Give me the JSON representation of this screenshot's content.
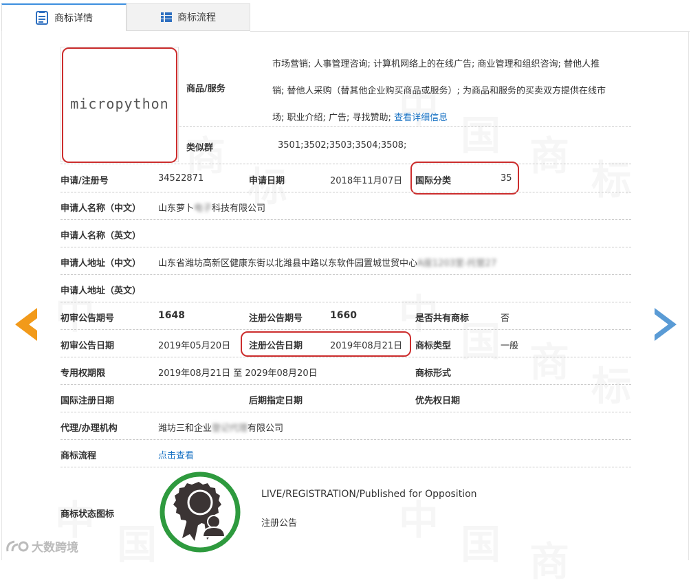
{
  "tabs": [
    {
      "label": "商标详情",
      "icon": "document-icon",
      "active": true
    },
    {
      "label": "商标流程",
      "icon": "list-icon",
      "active": false
    }
  ],
  "logo_text": "micropython",
  "goods": {
    "label": "商品/服务",
    "lines": [
      "市场营销; 人事管理咨询; 计算机网络上的在线广告; 商业管理和组织咨询; 替他人推",
      "销; 替他人采购（替其他企业购买商品或服务）; 为商品和服务的买卖双方提供在线市",
      "场; 职业介绍; 广告; 寻找赞助; "
    ],
    "link": "查看详细信息"
  },
  "similar_group": {
    "label": "类似群",
    "value": "3501;3502;3503;3504;3508;"
  },
  "fields": {
    "reg_no": {
      "label": "申请/注册号",
      "value": "34522871"
    },
    "apply_date": {
      "label": "申请日期",
      "value": "2018年11月07日"
    },
    "intl_class": {
      "label": "国际分类",
      "value": "35"
    },
    "applicant_cn": {
      "label": "申请人名称（中文）",
      "value_a": "山东萝卜",
      "value_blur": "电子",
      "value_b": "科技有限公司"
    },
    "applicant_en": {
      "label": "申请人名称（英文）",
      "value": ""
    },
    "address_cn": {
      "label": "申请人地址（中文）",
      "value": "山东省潍坊高新区健康东街以北潍县中路以东软件园置城世贸中心",
      "value_blur": "A座1203室-托管27"
    },
    "address_en": {
      "label": "申请人地址（英文）",
      "value": ""
    },
    "prelim_no": {
      "label": "初审公告期号",
      "value": "1648"
    },
    "reg_pub_no": {
      "label": "注册公告期号",
      "value": "1660"
    },
    "shared": {
      "label": "是否共有商标",
      "value": "否"
    },
    "prelim_date": {
      "label": "初审公告日期",
      "value": "2019年05月20日"
    },
    "reg_pub_date": {
      "label": "注册公告日期",
      "value": "2019年08月21日"
    },
    "tm_type": {
      "label": "商标类型",
      "value": "一般"
    },
    "exclusive": {
      "label": "专用权期限",
      "value": "2019年08月21日 至 2029年08月20日"
    },
    "tm_form": {
      "label": "商标形式",
      "value": ""
    },
    "intl_reg_date": {
      "label": "国际注册日期",
      "value": ""
    },
    "later_date": {
      "label": "后期指定日期",
      "value": ""
    },
    "priority_date": {
      "label": "优先权日期",
      "value": ""
    },
    "agent": {
      "label": "代理/办理机构",
      "value_a": "潍坊三和企业",
      "value_blur": "登记代理",
      "value_b": "有限公司"
    },
    "flow": {
      "label": "商标流程",
      "link": "点击查看"
    },
    "status_icon": {
      "label": "商标状态图标"
    }
  },
  "status": {
    "line1": "LIVE/REGISTRATION/Published for Opposition",
    "line2": "注册公告"
  },
  "corner_brand": "大数跨境",
  "colors": {
    "accent_blue": "#1a73c4",
    "highlight_red": "#cc2d2d",
    "badge_green": "#2e9a3e",
    "arrow_orange": "#f29a1a",
    "arrow_blue": "#5a9bd5"
  }
}
